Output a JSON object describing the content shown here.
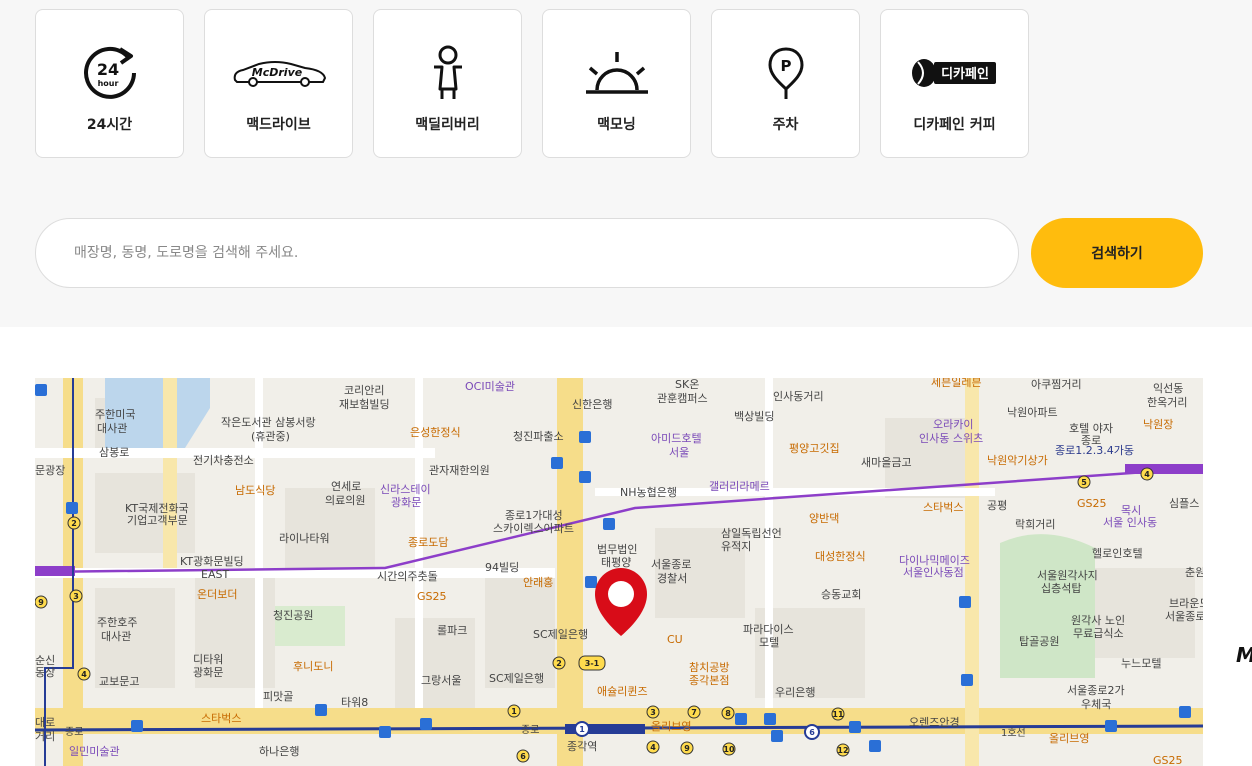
{
  "services": [
    {
      "label": "24시간",
      "icon": "clock-24-icon",
      "icon_text": "24",
      "icon_subtext": "hour"
    },
    {
      "label": "맥드라이브",
      "icon": "mcdrive-car-icon",
      "icon_text": "McDrive"
    },
    {
      "label": "맥딜리버리",
      "icon": "delivery-scooter-icon"
    },
    {
      "label": "맥모닝",
      "icon": "sunrise-icon"
    },
    {
      "label": "주차",
      "icon": "parking-pin-icon",
      "icon_text": "P"
    },
    {
      "label": "디카페인 커피",
      "icon": "decaf-coffee-icon",
      "icon_text": "디카페인"
    }
  ],
  "search": {
    "placeholder": "매장명, 동명, 도로명을 검색해 주세요.",
    "button_label": "검색하기"
  },
  "map": {
    "selected_store": "애슐리퀸즈",
    "labels": [
      {
        "text": "주한미국",
        "cls": ""
      },
      {
        "text": "대사관",
        "cls": ""
      },
      {
        "text": "코리안리",
        "cls": ""
      },
      {
        "text": "재보험빌딩",
        "cls": ""
      },
      {
        "text": "OCI미술관",
        "cls": "p"
      },
      {
        "text": "신한은행",
        "cls": ""
      },
      {
        "text": "SK온",
        "cls": ""
      },
      {
        "text": "관훈캠퍼스",
        "cls": ""
      },
      {
        "text": "인사동거리",
        "cls": ""
      },
      {
        "text": "세븐일레븐",
        "cls": "o"
      },
      {
        "text": "아쿠찜거리",
        "cls": ""
      },
      {
        "text": "익선동",
        "cls": ""
      },
      {
        "text": "한옥거리",
        "cls": ""
      },
      {
        "text": "작은도서관 삼봉서랑",
        "cls": ""
      },
      {
        "text": "(휴관중)",
        "cls": ""
      },
      {
        "text": "은성한정식",
        "cls": "o"
      },
      {
        "text": "청진파출소",
        "cls": ""
      },
      {
        "text": "백상빌딩",
        "cls": ""
      },
      {
        "text": "아미드호텔",
        "cls": "p"
      },
      {
        "text": "서울",
        "cls": "p"
      },
      {
        "text": "평양고깃집",
        "cls": "o"
      },
      {
        "text": "낙원아파트",
        "cls": ""
      },
      {
        "text": "오라카이",
        "cls": "p"
      },
      {
        "text": "인사동 스위츠",
        "cls": "p"
      },
      {
        "text": "호텔 야자",
        "cls": ""
      },
      {
        "text": "종로",
        "cls": ""
      },
      {
        "text": "낙원장",
        "cls": "o"
      },
      {
        "text": "삼봉로",
        "cls": ""
      },
      {
        "text": "전기차충전소",
        "cls": ""
      },
      {
        "text": "관자재한의원",
        "cls": ""
      },
      {
        "text": "새마을금고",
        "cls": ""
      },
      {
        "text": "낙원악기상가",
        "cls": "o"
      },
      {
        "text": "종로1.2.3.4가동",
        "cls": "b"
      },
      {
        "text": "KT국제전화국",
        "cls": ""
      },
      {
        "text": "기업고객부문",
        "cls": ""
      },
      {
        "text": "남도식당",
        "cls": "o"
      },
      {
        "text": "연세로",
        "cls": ""
      },
      {
        "text": "의료의원",
        "cls": ""
      },
      {
        "text": "신라스테이",
        "cls": "p"
      },
      {
        "text": "광화문",
        "cls": "p"
      },
      {
        "text": "NH농협은행",
        "cls": ""
      },
      {
        "text": "갤러리라메르",
        "cls": "p"
      },
      {
        "text": "스타벅스",
        "cls": "o"
      },
      {
        "text": "공평",
        "cls": ""
      },
      {
        "text": "GS25",
        "cls": "o"
      },
      {
        "text": "심플스",
        "cls": ""
      },
      {
        "text": "종로1가대성",
        "cls": ""
      },
      {
        "text": "스카이렉스아파트",
        "cls": ""
      },
      {
        "text": "양반댁",
        "cls": "o"
      },
      {
        "text": "목시",
        "cls": "p"
      },
      {
        "text": "서울 인사동",
        "cls": "p"
      },
      {
        "text": "라이나타워",
        "cls": ""
      },
      {
        "text": "종로도담",
        "cls": "o"
      },
      {
        "text": "삼일독립선언",
        "cls": ""
      },
      {
        "text": "유적지",
        "cls": ""
      },
      {
        "text": "락희거리",
        "cls": ""
      },
      {
        "text": "헬로인호텔",
        "cls": ""
      },
      {
        "text": "KT광화문빌딩",
        "cls": ""
      },
      {
        "text": "EAST",
        "cls": ""
      },
      {
        "text": "94빌딩",
        "cls": ""
      },
      {
        "text": "법무법인",
        "cls": ""
      },
      {
        "text": "태평양",
        "cls": ""
      },
      {
        "text": "서울종로",
        "cls": ""
      },
      {
        "text": "경찰서",
        "cls": ""
      },
      {
        "text": "대성한정식",
        "cls": "o"
      },
      {
        "text": "다이나믹메이즈",
        "cls": "p"
      },
      {
        "text": "서울인사동점",
        "cls": "p"
      },
      {
        "text": "시간의주춧돌",
        "cls": ""
      },
      {
        "text": "안래홍",
        "cls": "o"
      },
      {
        "text": "승동교회",
        "cls": ""
      },
      {
        "text": "서울원각사지",
        "cls": ""
      },
      {
        "text": "십층석탑",
        "cls": ""
      },
      {
        "text": "춘원",
        "cls": ""
      },
      {
        "text": "주한호주",
        "cls": ""
      },
      {
        "text": "대사관",
        "cls": ""
      },
      {
        "text": "온더보더",
        "cls": "o"
      },
      {
        "text": "청진공원",
        "cls": ""
      },
      {
        "text": "GS25",
        "cls": "o"
      },
      {
        "text": "롤파크",
        "cls": ""
      },
      {
        "text": "SC제일은행",
        "cls": ""
      },
      {
        "text": "CU",
        "cls": "o"
      },
      {
        "text": "파라다이스",
        "cls": ""
      },
      {
        "text": "모텔",
        "cls": ""
      },
      {
        "text": "탑골공원",
        "cls": ""
      },
      {
        "text": "원각사 노인",
        "cls": ""
      },
      {
        "text": "무료급식소",
        "cls": ""
      },
      {
        "text": "브라운도",
        "cls": ""
      },
      {
        "text": "서울종로",
        "cls": ""
      },
      {
        "text": "순신",
        "cls": ""
      },
      {
        "text": "동상",
        "cls": ""
      },
      {
        "text": "교보문고",
        "cls": ""
      },
      {
        "text": "디타워",
        "cls": ""
      },
      {
        "text": "광화문",
        "cls": ""
      },
      {
        "text": "후니도니",
        "cls": "o"
      },
      {
        "text": "그랑서울",
        "cls": ""
      },
      {
        "text": "SC제일은행",
        "cls": ""
      },
      {
        "text": "참치공방",
        "cls": "o"
      },
      {
        "text": "종각본점",
        "cls": "o"
      },
      {
        "text": "누느모텔",
        "cls": ""
      },
      {
        "text": "피맛골",
        "cls": ""
      },
      {
        "text": "타워8",
        "cls": ""
      },
      {
        "text": "우리은행",
        "cls": ""
      },
      {
        "text": "서울종로2가",
        "cls": ""
      },
      {
        "text": "우체국",
        "cls": ""
      },
      {
        "text": "스타벅스",
        "cls": "o"
      },
      {
        "text": "올리브영",
        "cls": "o"
      },
      {
        "text": "오렌즈안경",
        "cls": ""
      },
      {
        "text": "대로",
        "cls": ""
      },
      {
        "text": "거리",
        "cls": ""
      },
      {
        "text": "종로",
        "cls": ""
      },
      {
        "text": "종각역",
        "cls": ""
      },
      {
        "text": "1호선",
        "cls": ""
      },
      {
        "text": "일민미술관",
        "cls": "p"
      },
      {
        "text": "하나은행",
        "cls": ""
      },
      {
        "text": "올리브영",
        "cls": "o"
      },
      {
        "text": "GS25",
        "cls": "o"
      },
      {
        "text": "문광장",
        "cls": ""
      }
    ],
    "bus_numbers": [
      "2",
      "3",
      "9",
      "4",
      "1",
      "2",
      "3-1",
      "1",
      "3",
      "4",
      "6",
      "7",
      "8",
      "9",
      "10",
      "11",
      "12",
      "6",
      "5",
      "4"
    ]
  },
  "edge_text": "M",
  "colors": {
    "accent": "#ffbc0d",
    "pin": "#d80c18",
    "subway_line1": "#263c96",
    "subway_line5": "#8d3ec9",
    "road_major": "#f6dd8a",
    "park": "#cfe6c7"
  }
}
